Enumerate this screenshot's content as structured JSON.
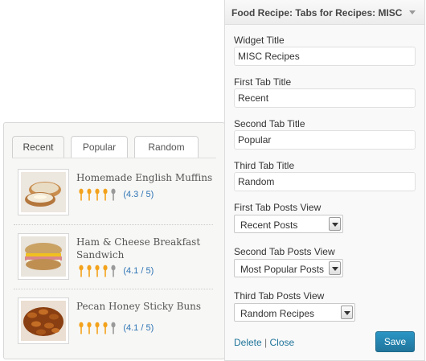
{
  "recipe_tabs": {
    "tabs": [
      {
        "label": "Recent",
        "active": true
      },
      {
        "label": "Popular",
        "active": false
      },
      {
        "label": "Random",
        "active": false
      }
    ],
    "rating_icon": "spoon-icon",
    "rating_color": "#f3a21c",
    "rating_empty_color": "#9a9a9a",
    "recipes": [
      {
        "title": "Homemade English Muffins",
        "rating": 4.3,
        "rating_text": "(4.3 / 5)",
        "image": "english-muffin-photo"
      },
      {
        "title": "Ham & Cheese Breakfast Sandwich",
        "rating": 4.1,
        "rating_text": "(4.1 / 5)",
        "image": "breakfast-sandwich-photo"
      },
      {
        "title": "Pecan Honey Sticky Buns",
        "rating": 4.1,
        "rating_text": "(4.1 / 5)",
        "image": "sticky-buns-photo"
      }
    ]
  },
  "widget_panel": {
    "title": "Food Recipe: Tabs for Recipes: MISC R",
    "fields": {
      "widget_title": {
        "label": "Widget Title",
        "value": "MISC Recipes"
      },
      "first_tab_title": {
        "label": "First Tab Title",
        "value": "Recent"
      },
      "second_tab_title": {
        "label": "Second Tab Title",
        "value": "Popular"
      },
      "third_tab_title": {
        "label": "Third Tab Title",
        "value": "Random"
      }
    },
    "selects": {
      "first_view": {
        "label": "First Tab Posts View",
        "value": "Recent Posts"
      },
      "second_view": {
        "label": "Second Tab Posts View",
        "value": "Most Popular Posts"
      },
      "third_view": {
        "label": "Third Tab Posts View",
        "value": "Random Recipes"
      }
    },
    "delete_label": "Delete",
    "separator": "|",
    "close_label": "Close",
    "save_label": "Save",
    "accent_color": "#21759b"
  }
}
